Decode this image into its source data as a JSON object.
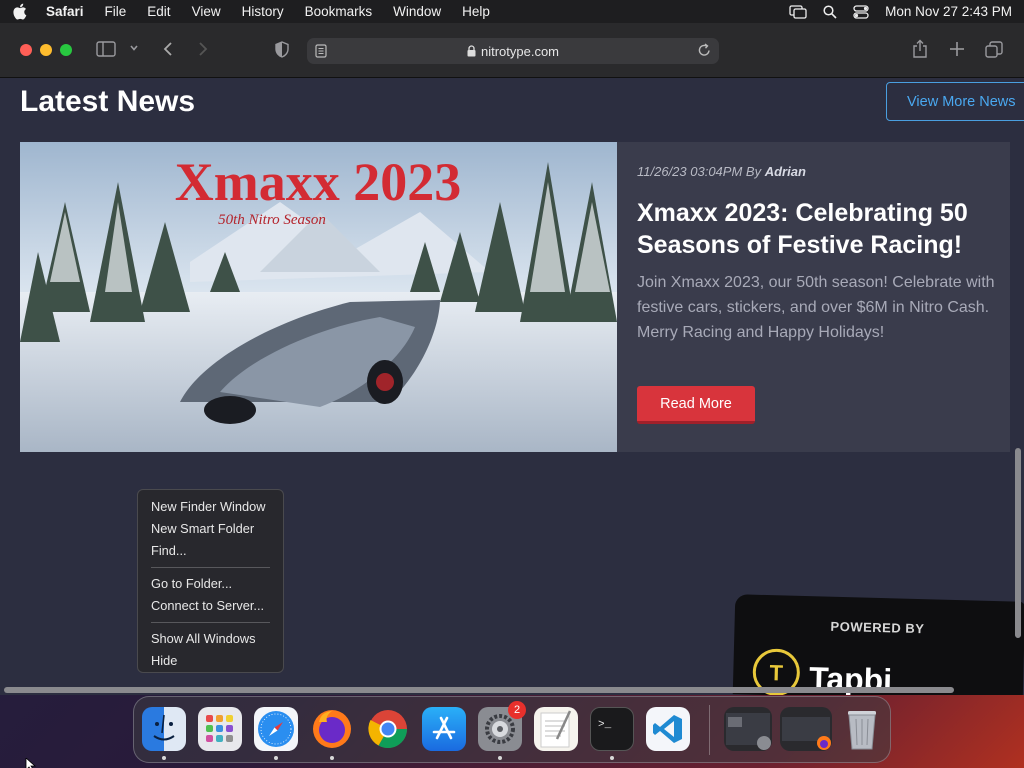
{
  "menubar": {
    "items": [
      "Safari",
      "File",
      "Edit",
      "View",
      "History",
      "Bookmarks",
      "Window",
      "Help"
    ],
    "clock": "Mon Nov 27  2:43 PM"
  },
  "browser": {
    "url": "nitrotype.com"
  },
  "page": {
    "section_title": "Latest News",
    "view_more_label": "View More News",
    "article": {
      "date": "11/26/23 03:04PM",
      "by_label": "By",
      "author": "Adrian",
      "title": "Xmaxx 2023: Celebrating 50 Seasons of Festive Racing!",
      "description": "Join Xmaxx 2023, our 50th season! Celebrate with festive cars, stickers, and over $6M in Nitro Cash. Merry Racing and Happy Holidays!",
      "read_more_label": "Read More",
      "image_title": "Xmaxx 2023",
      "image_subtitle": "50th Nitro Season"
    },
    "powered_by_label": "POWERED BY",
    "powered_by_brand": "Tapbi"
  },
  "context_menu": {
    "group1": [
      "New Finder Window",
      "New Smart Folder",
      "Find..."
    ],
    "group2": [
      "Go to Folder...",
      "Connect to Server..."
    ],
    "group3": [
      "Show All Windows",
      "Hide"
    ]
  },
  "dock": {
    "apps": [
      "Finder",
      "Launchpad",
      "Safari",
      "Firefox",
      "Chrome",
      "App Store",
      "System Settings",
      "TextEdit",
      "Terminal",
      "VS Code"
    ],
    "settings_badge": "2"
  },
  "colors": {
    "accent_red": "#d8343c",
    "link_blue": "#4aa8f0",
    "page_bg": "#2c2e40"
  }
}
